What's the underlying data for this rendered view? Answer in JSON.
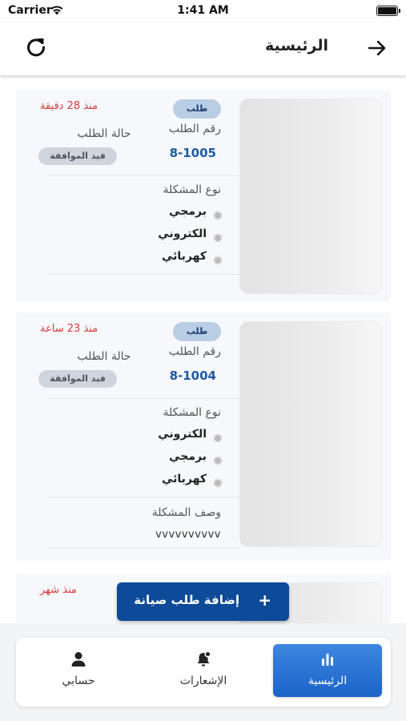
{
  "status_bar": {
    "carrier": "Carrier",
    "time": "1:41 AM"
  },
  "header": {
    "title": "الرئيسية"
  },
  "labels": {
    "order_number": "رقم الطلب",
    "order_status": "حالة الطلب",
    "problem_type": "نوع المشكلة",
    "problem_description": "وصف المشكلة"
  },
  "orders": [
    {
      "type_badge": "طلب",
      "time_ago": "منذ 28 دقيقة",
      "order_number": "8-1005",
      "status": "قيد الموافقة",
      "problem_types": [
        "برمجي",
        "الكتروني",
        "كهربائي"
      ]
    },
    {
      "type_badge": "طلب",
      "time_ago": "منذ 23 ساعة",
      "order_number": "8-1004",
      "status": "قيد الموافقة",
      "problem_types": [
        "الكتروني",
        "برمجي",
        "كهربائي"
      ],
      "description": "vvvvvvvvvv"
    },
    {
      "time_ago": "منذ شهر"
    }
  ],
  "fab": {
    "label": "إضافة طلب صيانة",
    "icon": "plus-icon"
  },
  "nav": {
    "home": {
      "label": "الرئيسية",
      "icon": "bar-chart-icon",
      "active": true
    },
    "notifications": {
      "label": "الإشعارات",
      "icon": "bell-icon"
    },
    "account": {
      "label": "حسابي",
      "icon": "user-icon"
    }
  },
  "colors": {
    "primary": "#0d4a98",
    "nav_active": "#1a63c8",
    "order_number": "#1f5aa3",
    "time_ago": "#d63a3a",
    "badge_bg": "#b9cde4",
    "status_pill_bg": "#cfd5dc"
  }
}
